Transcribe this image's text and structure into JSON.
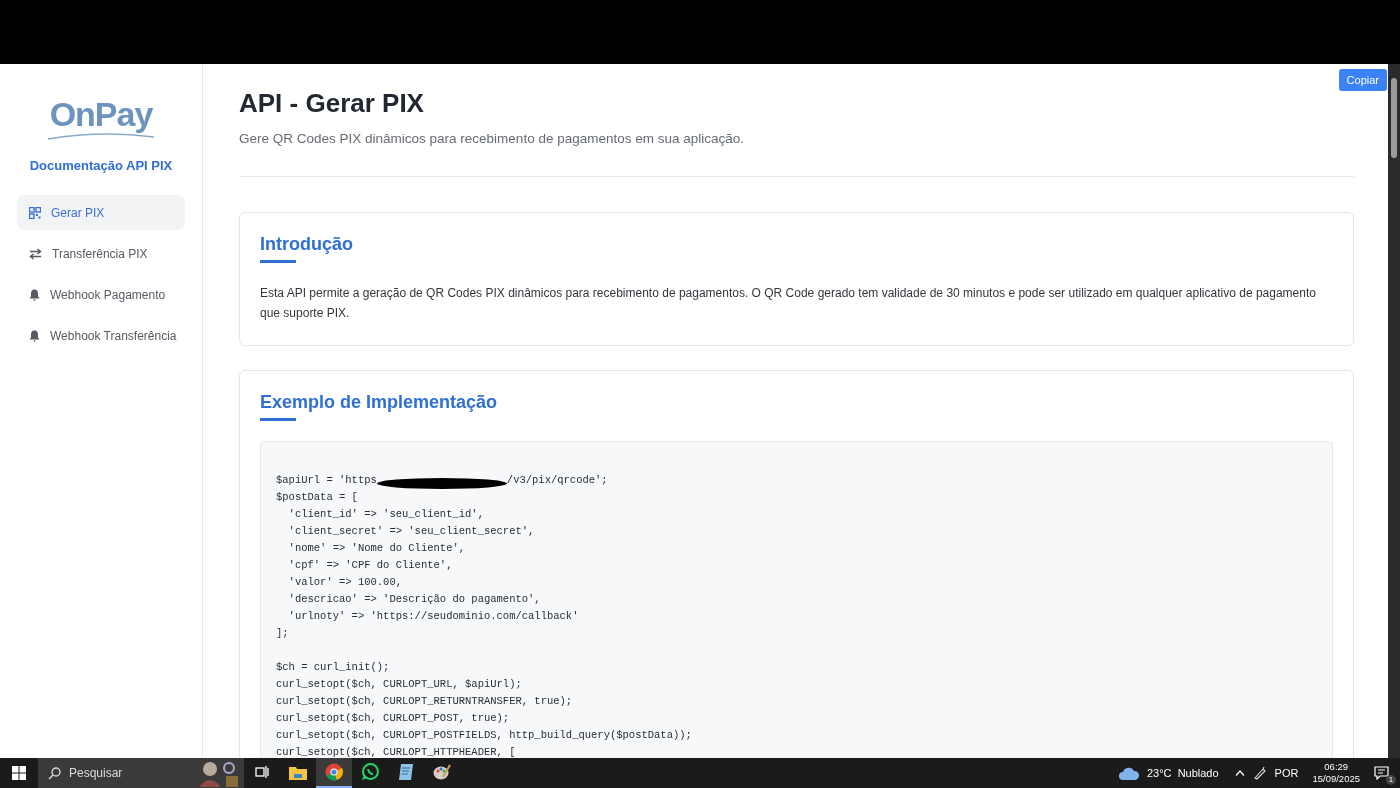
{
  "sidebar": {
    "logo": "OnPay",
    "subtitle": "Documentação API PIX",
    "items": [
      {
        "label": "Gerar PIX",
        "kind": "qr",
        "selected": true
      },
      {
        "label": "Transferência PIX",
        "kind": "transfer",
        "selected": false
      },
      {
        "label": "Webhook Pagamento",
        "kind": "bell",
        "selected": false
      },
      {
        "label": "Webhook Transferência",
        "kind": "bell",
        "selected": false
      }
    ]
  },
  "copy_button": "Copiar",
  "header": {
    "title": "API - Gerar PIX",
    "subtitle": "Gere QR Codes PIX dinâmicos para recebimento de pagamentos em sua aplicação."
  },
  "sections": [
    {
      "kind": "text",
      "title": "Introdução",
      "body": "Esta API permite a geração de QR Codes PIX dinâmicos para recebimento de pagamentos. O QR Code gerado tem validade de 30 minutos e pode ser utilizado em qualquer aplicativo de pagamento que suporte PIX."
    },
    {
      "kind": "code",
      "title": "Exemplo de Implementação",
      "lines": [
        {
          "kind": "redacted",
          "before": "$apiUrl = 'https",
          "after": "/v3/pix/qrcode';"
        },
        {
          "kind": "code",
          "text": "$postData = ["
        },
        {
          "kind": "code",
          "text": "  'client_id' => 'seu_client_id',"
        },
        {
          "kind": "code",
          "text": "  'client_secret' => 'seu_client_secret',"
        },
        {
          "kind": "code",
          "text": "  'nome' => 'Nome do Cliente',"
        },
        {
          "kind": "code",
          "text": "  'cpf' => 'CPF do Cliente',"
        },
        {
          "kind": "code",
          "text": "  'valor' => 100.00,"
        },
        {
          "kind": "code",
          "text": "  'descricao' => 'Descrição do pagamento',"
        },
        {
          "kind": "code",
          "text": "  'urlnoty' => 'https://seudominio.com/callback'"
        },
        {
          "kind": "code",
          "text": "];"
        },
        {
          "kind": "blank"
        },
        {
          "kind": "code",
          "text": "$ch = curl_init();"
        },
        {
          "kind": "code",
          "text": "curl_setopt($ch, CURLOPT_URL, $apiUrl);"
        },
        {
          "kind": "code",
          "text": "curl_setopt($ch, CURLOPT_RETURNTRANSFER, true);"
        },
        {
          "kind": "code",
          "text": "curl_setopt($ch, CURLOPT_POST, true);"
        },
        {
          "kind": "code",
          "text": "curl_setopt($ch, CURLOPT_POSTFIELDS, http_build_query($postData));"
        },
        {
          "kind": "code",
          "text": "curl_setopt($ch, CURLOPT_HTTPHEADER, ["
        }
      ]
    }
  ],
  "taskbar": {
    "search_placeholder": "Pesquisar",
    "apps": [
      {
        "kind": "taskview",
        "selected": false
      },
      {
        "kind": "folder",
        "selected": false
      },
      {
        "kind": "chrome",
        "selected": true
      },
      {
        "kind": "whatsapp",
        "selected": false
      },
      {
        "kind": "notepad",
        "selected": false
      },
      {
        "kind": "paint",
        "selected": false
      }
    ],
    "weather": "23°C  Nublado",
    "language": "POR",
    "time": "06:29",
    "date": "15/09/2025",
    "notifications": "1"
  }
}
